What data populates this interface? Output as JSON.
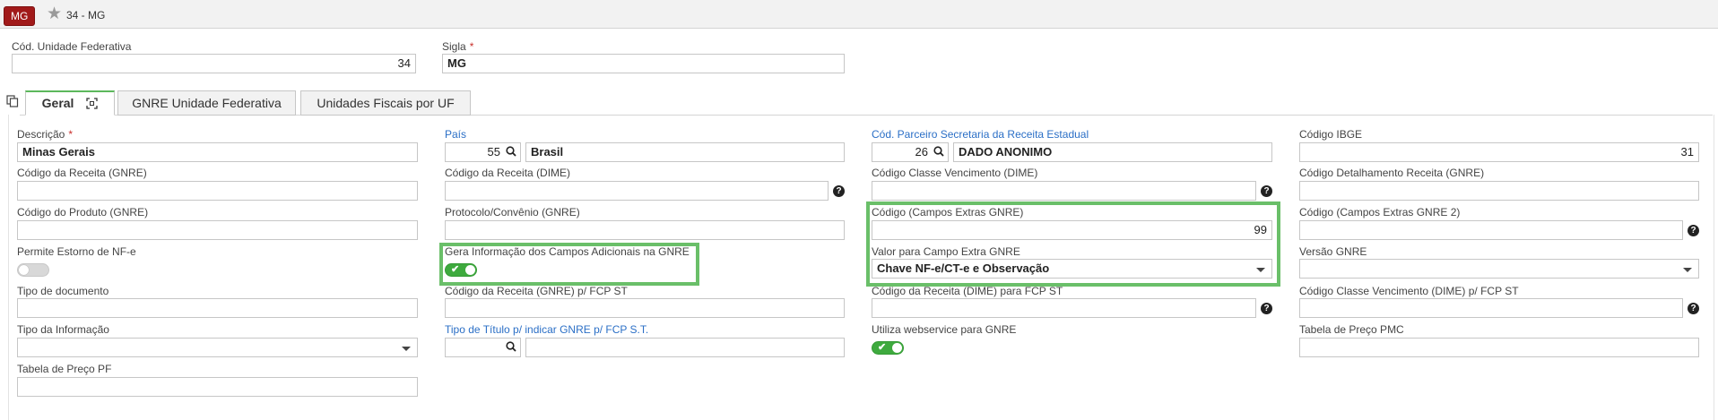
{
  "header": {
    "badge": "MG",
    "title": "34 - MG"
  },
  "top_form": {
    "cod_uf": {
      "label": "Cód. Unidade Federativa",
      "value": "34"
    },
    "sigla": {
      "label": "Sigla",
      "required": "*",
      "value": "MG"
    }
  },
  "tabs": [
    {
      "label": "Geral"
    },
    {
      "label": "GNRE Unidade Federativa"
    },
    {
      "label": "Unidades Fiscais por UF"
    }
  ],
  "fields": {
    "descricao": {
      "label": "Descrição",
      "required": "*",
      "value": "Minas Gerais"
    },
    "pais": {
      "label": "País",
      "code": "55",
      "name": "Brasil"
    },
    "cod_parceiro": {
      "label": "Cód. Parceiro Secretaria da Receita Estadual",
      "code": "26",
      "name": "DADO ANONIMO"
    },
    "codigo_ibge": {
      "label": "Código IBGE",
      "value": "31"
    },
    "cod_receita_gnre": {
      "label": "Código da Receita (GNRE)",
      "value": ""
    },
    "cod_receita_dime": {
      "label": "Código da Receita (DIME)",
      "value": ""
    },
    "cod_classe_venc_dime": {
      "label": "Código Classe Vencimento (DIME)",
      "value": ""
    },
    "cod_detalhamento_gnre": {
      "label": "Código Detalhamento Receita (GNRE)",
      "value": ""
    },
    "cod_produto_gnre": {
      "label": "Código do Produto (GNRE)",
      "value": ""
    },
    "protocolo_convenio": {
      "label": "Protocolo/Convênio (GNRE)",
      "value": ""
    },
    "cod_campos_extras": {
      "label": "Código (Campos Extras GNRE)",
      "value": "99"
    },
    "cod_campos_extras2": {
      "label": "Código (Campos Extras GNRE 2)",
      "value": ""
    },
    "permite_estorno": {
      "label": "Permite Estorno de NF-e",
      "state": "off"
    },
    "gera_info": {
      "label": "Gera Informação dos Campos Adicionais na GNRE",
      "state": "on"
    },
    "valor_campo_extra": {
      "label": "Valor para Campo Extra GNRE",
      "value": "Chave NF-e/CT-e e Observação"
    },
    "versao_gnre": {
      "label": "Versão GNRE",
      "value": ""
    },
    "tipo_documento": {
      "label": "Tipo de documento",
      "value": ""
    },
    "cod_receita_gnre_fcp": {
      "label": "Código da Receita (GNRE) p/ FCP ST",
      "value": ""
    },
    "cod_receita_dime_fcp": {
      "label": "Código da Receita (DIME) para FCP ST",
      "value": ""
    },
    "cod_classe_venc_dime_fcp": {
      "label": "Código Classe Vencimento (DIME) p/ FCP ST",
      "value": ""
    },
    "tipo_informacao": {
      "label": "Tipo da Informação",
      "value": ""
    },
    "tipo_titulo": {
      "label": "Tipo de Título p/ indicar GNRE p/ FCP S.T.",
      "code": "",
      "name": ""
    },
    "utiliza_webservice": {
      "label": "Utiliza webservice para GNRE",
      "state": "on"
    },
    "tabela_pmc": {
      "label": "Tabela de Preço PMC",
      "value": ""
    },
    "tabela_pf": {
      "label": "Tabela de Preço PF",
      "value": ""
    }
  },
  "icons": {
    "help": "?",
    "star": "★",
    "check": "✔"
  },
  "colors": {
    "badge": "#a11a1a",
    "toggle_on": "#3eaa3e",
    "highlight": "#6abf69",
    "link_label": "#2b6fc6",
    "tab_active_border": "#5cb85c"
  }
}
